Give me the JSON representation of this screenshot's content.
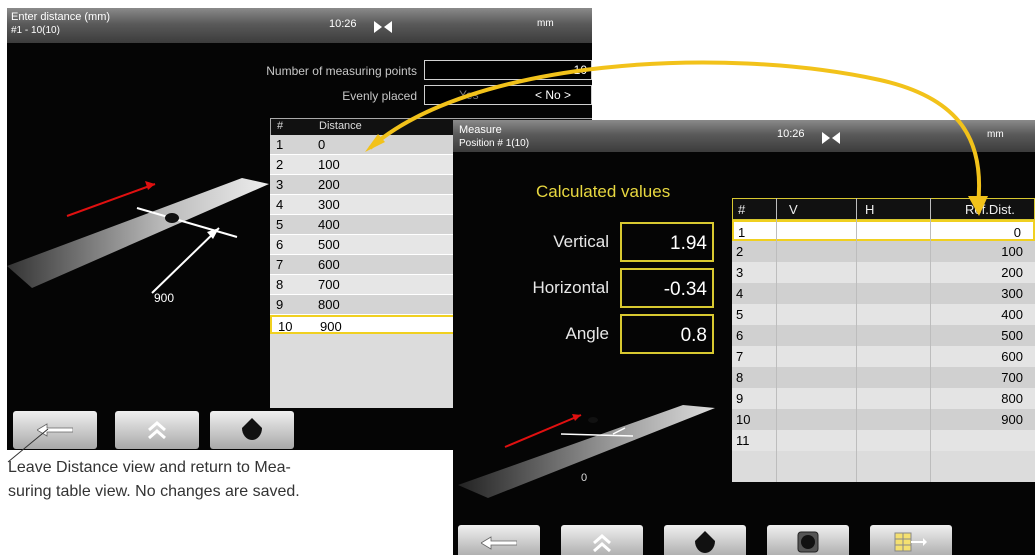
{
  "distance_screen": {
    "title_line1": "Enter distance (mm)",
    "title_line2": "#1 - 10(10)",
    "clock": "10:26",
    "unit": "mm",
    "num_points_label": "Number of measuring points",
    "num_points_value": "10",
    "evenly_placed_label": "Evenly placed",
    "evenly_yes": "Yes",
    "evenly_no": "< No >",
    "table_headers": [
      "#",
      "Distance"
    ],
    "rows": [
      {
        "n": "1",
        "v": "0"
      },
      {
        "n": "2",
        "v": "100"
      },
      {
        "n": "3",
        "v": "200"
      },
      {
        "n": "4",
        "v": "300"
      },
      {
        "n": "5",
        "v": "400"
      },
      {
        "n": "6",
        "v": "500"
      },
      {
        "n": "7",
        "v": "600"
      },
      {
        "n": "8",
        "v": "700"
      },
      {
        "n": "9",
        "v": "800"
      },
      {
        "n": "10",
        "v": "900"
      }
    ],
    "selected_row": 9,
    "illustration_distance": "900"
  },
  "measure_screen": {
    "title_line1": "Measure",
    "title_line2": "Position # 1(10)",
    "clock": "10:26",
    "unit": "mm",
    "calc_title": "Calculated values",
    "vertical_label": "Vertical",
    "vertical_value": "1.94",
    "horizontal_label": "Horizontal",
    "horizontal_value": "-0.34",
    "angle_label": "Angle",
    "angle_value": "0.8",
    "table_headers": [
      "#",
      "V",
      "H",
      "Ref.Dist."
    ],
    "rows": [
      {
        "n": "1",
        "v": "0"
      },
      {
        "n": "2",
        "v": "100"
      },
      {
        "n": "3",
        "v": "200"
      },
      {
        "n": "4",
        "v": "300"
      },
      {
        "n": "5",
        "v": "400"
      },
      {
        "n": "6",
        "v": "500"
      },
      {
        "n": "7",
        "v": "600"
      },
      {
        "n": "8",
        "v": "700"
      },
      {
        "n": "9",
        "v": "800"
      },
      {
        "n": "10",
        "v": "900"
      },
      {
        "n": "11",
        "v": ""
      }
    ],
    "selected_row": 0,
    "illustration_distance": "0"
  },
  "caption": {
    "line1": "Leave Distance view and return to Mea-",
    "line2": "suring table view. No changes are saved."
  },
  "colors": {
    "highlight": "#f0d020",
    "arrow": "#f2c21a",
    "value_border": "#d8c830"
  }
}
